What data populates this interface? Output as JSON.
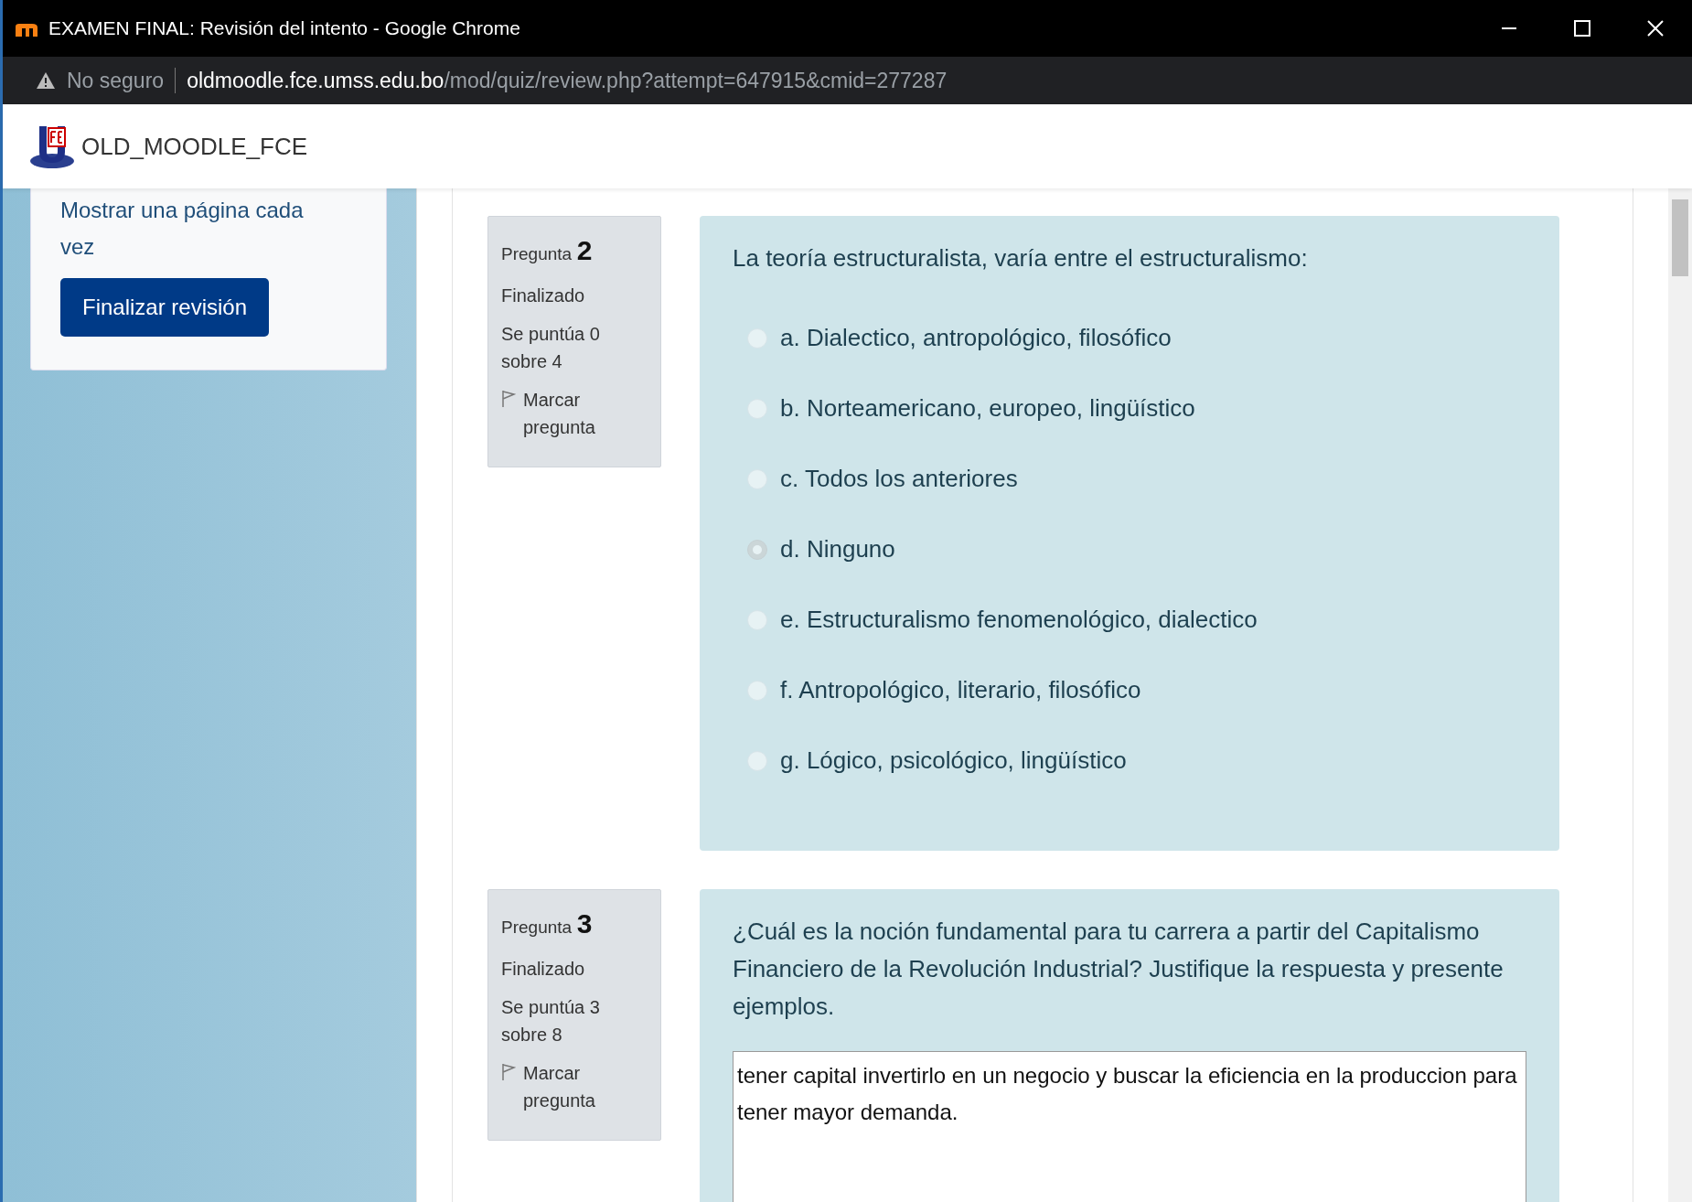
{
  "window": {
    "title": "EXAMEN FINAL: Revisión del intento - Google Chrome"
  },
  "address_bar": {
    "security": "No seguro",
    "domain": "oldmoodle.fce.umss.edu.bo",
    "path": "/mod/quiz/review.php?attempt=647915&cmid=277287"
  },
  "site": {
    "name": "OLD_MOODLE_FCE"
  },
  "sidebar": {
    "link_text": "Mostrar una página cada vez",
    "button": "Finalizar revisión"
  },
  "questions": [
    {
      "kind": "multichoice",
      "label": "Pregunta",
      "number": "2",
      "state": "Finalizado",
      "grade": "Se puntúa 0 sobre 4",
      "flag": "Marcar pregunta",
      "text": "La teoría estructuralista, varía entre el estructuralismo:",
      "options": [
        {
          "label": "a. Dialectico, antropológico, filosófico",
          "selected": false
        },
        {
          "label": "b. Norteamericano, europeo, lingüístico",
          "selected": false
        },
        {
          "label": "c. Todos los anteriores",
          "selected": false
        },
        {
          "label": "d. Ninguno",
          "selected": true
        },
        {
          "label": "e. Estructuralismo fenomenológico, dialectico",
          "selected": false
        },
        {
          "label": "f. Antropológico, literario, filosófico",
          "selected": false
        },
        {
          "label": "g. Lógico, psicológico, lingüístico",
          "selected": false
        }
      ]
    },
    {
      "kind": "essay",
      "label": "Pregunta",
      "number": "3",
      "state": "Finalizado",
      "grade": "Se puntúa 3 sobre 8",
      "flag": "Marcar pregunta",
      "text": "¿Cuál es la noción fundamental para tu carrera a partir del Capitalismo Financiero de la Revolución Industrial? Justifique la respuesta y presente ejemplos.",
      "answer": "tener capital invertirlo en un negocio y buscar la eficiencia en la produccion para tener mayor demanda."
    }
  ]
}
